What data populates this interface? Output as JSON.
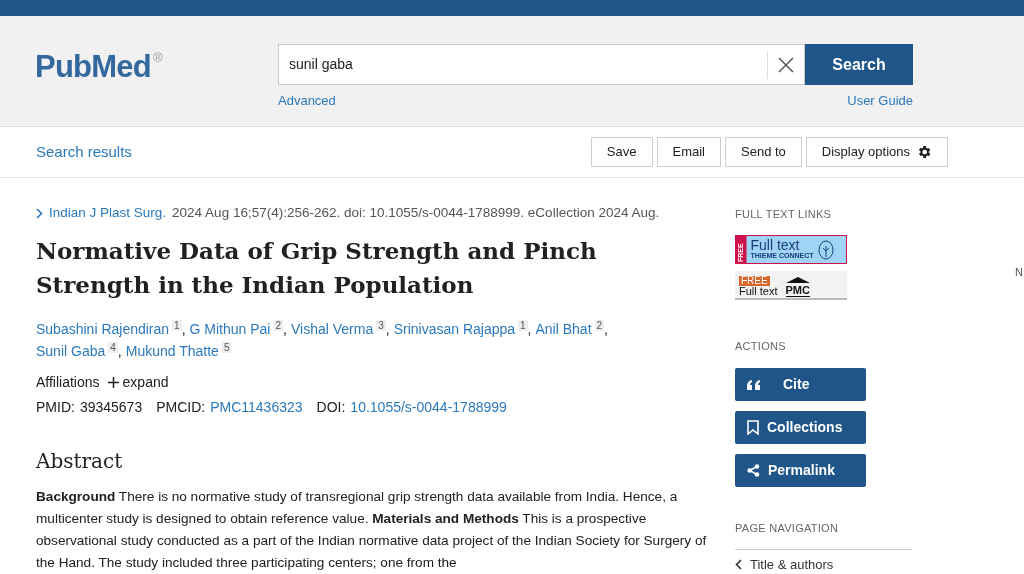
{
  "header": {
    "logo": {
      "text": "PubMed",
      "mark": "®"
    },
    "search": {
      "value": "sunil gaba",
      "button": "Search"
    },
    "advanced": "Advanced",
    "user_guide": "User Guide"
  },
  "toolbar": {
    "back": "Search results",
    "buttons": [
      {
        "label": "Save",
        "kind": "plain"
      },
      {
        "label": "Email",
        "kind": "plain"
      },
      {
        "label": "Send to",
        "kind": "plain"
      },
      {
        "label": "Display options",
        "kind": "gear"
      }
    ]
  },
  "article": {
    "journal": "Indian J Plast Surg.",
    "citation": "2024 Aug 16;57(4):256-262. doi: 10.1055/s-0044-1788999. eCollection 2024 Aug.",
    "title": "Normative Data of Grip Strength and Pinch Strength in the Indian Population",
    "authors": [
      {
        "name": "Subashini Rajendiran",
        "aff": "1",
        "sep": ","
      },
      {
        "name": "G Mithun Pai",
        "aff": "2",
        "sep": ","
      },
      {
        "name": "Vishal Verma",
        "aff": "3",
        "sep": ","
      },
      {
        "name": "Srinivasan Rajappa",
        "aff": "1",
        "sep": ","
      },
      {
        "name": "Anil Bhat",
        "aff": "2",
        "sep": ","
      },
      {
        "name": "Sunil Gaba",
        "aff": "4",
        "sep": ","
      },
      {
        "name": "Mukund Thatte",
        "aff": "5"
      }
    ],
    "affiliations": {
      "label": "Affiliations",
      "toggle": "expand",
      "expanded": false
    },
    "ids": [
      {
        "label": "PMID:",
        "value": "39345673",
        "kind": "plain"
      },
      {
        "label": "PMCID:",
        "value": "PMC11436323",
        "kind": "link"
      },
      {
        "label": "DOI:",
        "value": "10.1055/s-0044-1788999",
        "kind": "link"
      }
    ],
    "abstract": {
      "heading": "Abstract",
      "text": "**Background** There is no normative study of transregional grip strength data available from India. Hence, a multicenter study is designed to obtain reference value. **Materials and Methods** This is a prospective observational study conducted as a part of the Indian normative data project of the Indian Society for Surgery of the Hand. The study included three participating centers; one from the"
    }
  },
  "sidebar": {
    "full_text_heading": "FULL TEXT LINKS",
    "links": [
      {
        "kind": "thieme",
        "free": "FREE",
        "label": "Full text",
        "sub": "THIEME CONNECT"
      },
      {
        "kind": "pmc",
        "free": "FREE",
        "label": "Full text",
        "sub": "PMC"
      }
    ],
    "actions_heading": "ACTIONS",
    "actions": [
      {
        "label": "Cite",
        "kind": "quote"
      },
      {
        "label": "Collections",
        "kind": "bookmark"
      },
      {
        "label": "Permalink",
        "kind": "share"
      }
    ],
    "nav_heading": "PAGE NAVIGATION",
    "nav": [
      {
        "label": "Title & authors"
      }
    ],
    "edge_text": "N"
  }
}
